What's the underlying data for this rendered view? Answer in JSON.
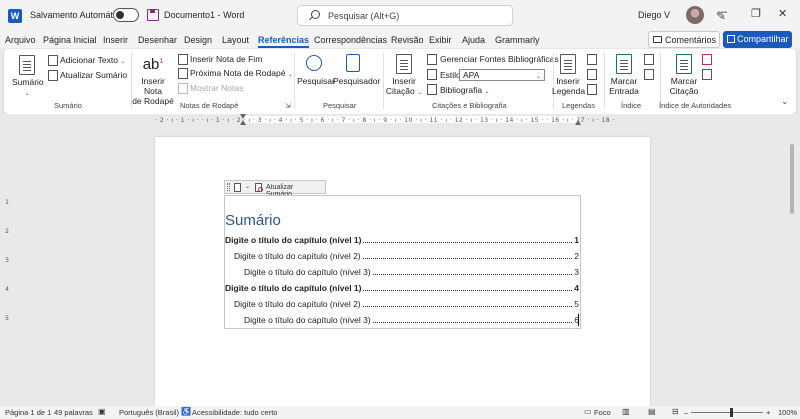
{
  "titlebar": {
    "autosave_label": "Salvamento Automático",
    "document": "Documento1",
    "separator": "-",
    "app": "Word",
    "search_placeholder": "Pesquisar (Alt+G)",
    "user": "Diego V",
    "window_controls": [
      "minimize-icon",
      "restore-icon",
      "close-icon"
    ]
  },
  "tabs": [
    "Arquivo",
    "Página Inicial",
    "Inserir",
    "Desenhar",
    "Design",
    "Layout",
    "Referências",
    "Correspondências",
    "Revisão",
    "Exibir",
    "Ajuda",
    "Grammarly"
  ],
  "active_tab": "Referências",
  "actions": {
    "comments": "Comentários",
    "share": "Compartilhar"
  },
  "ribbon": {
    "sumario": {
      "big": [
        "Sumário"
      ],
      "small": [
        "Adicionar Texto",
        "Atualizar Sumário"
      ],
      "group": "Sumário"
    },
    "notas": {
      "big": [
        "Inserir Nota",
        "de Rodapé"
      ],
      "small": [
        "Inserir Nota de Fim",
        "Próxima Nota de Rodapé",
        "Mostrar Notas"
      ],
      "group": "Notas de Rodapé"
    },
    "pesquisar": {
      "big1": "Pesquisar",
      "big2": "Pesquisador",
      "group": "Pesquisar"
    },
    "citacoes": {
      "big": [
        "Inserir",
        "Citação"
      ],
      "small": [
        "Gerenciar Fontes Bibliográficas",
        "Estilo:",
        "Bibliografia"
      ],
      "style_value": "APA",
      "group": "Citações e Bibliografia"
    },
    "legendas": {
      "big": [
        "Inserir",
        "Legenda"
      ],
      "group": "Legendas"
    },
    "indice": {
      "big": [
        "Marcar",
        "Entrada"
      ],
      "group": "Índice"
    },
    "autoridades": {
      "big": [
        "Marcar",
        "Citação"
      ],
      "group": "Índice de Autoridades"
    }
  },
  "ruler": {
    "horizontal": "· 2 · ı · 1 · ı ·  · ı · 1 · ı · 2 · ı · 3 · ı · 4 · ı · 5 · ı · 6 · ı · 7 · ı · 8 · ı · 9 · ı · 10 · ı · 11 · ı · 12 · ı · 13 · ı · 14 · ı · 15 ·  · 16 · ı · 17 · ı · 18 ·",
    "vertical": [
      "1",
      "2",
      "3",
      "4",
      "5"
    ]
  },
  "toc": {
    "toolbar_label": "Atualizar Sumário...",
    "title": "Sumário",
    "entries": [
      {
        "text": "Digite o título do capítulo (nível 1)",
        "page": "1",
        "level": 1
      },
      {
        "text": "Digite o título do capítulo (nível 2)",
        "page": "2",
        "level": 2
      },
      {
        "text": "Digite o título do capítulo (nível 3)",
        "page": "3",
        "level": 3
      },
      {
        "text": "Digite o título do capítulo (nível 1)",
        "page": "4",
        "level": 1
      },
      {
        "text": "Digite o título do capítulo (nível 2)",
        "page": "5",
        "level": 2
      },
      {
        "text": "Digite o título do capítulo (nível 3)",
        "page": "6",
        "level": 3
      }
    ]
  },
  "status": {
    "page": "Página 1 de 1",
    "words": "49 palavras",
    "language": "Português (Brasil)",
    "accessibility": "Acessibilidade: tudo certo",
    "focus": "Foco",
    "zoom": "100%"
  },
  "colors": {
    "accent": "#185abd",
    "heading": "#2f5496"
  }
}
